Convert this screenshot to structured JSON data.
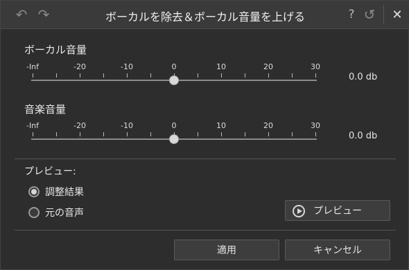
{
  "window": {
    "title": "ボーカルを除去＆ボーカル音量を上げる"
  },
  "titlebar": {
    "undo_icon": "↶",
    "redo_icon": "↷",
    "help_icon": "?",
    "reset_icon": "↺",
    "close_icon": "✕"
  },
  "vocal": {
    "label": "ボーカル音量",
    "ticks": [
      "-Inf",
      "-20",
      "-10",
      "0",
      "10",
      "20",
      "30"
    ],
    "value_text": "0.0 db",
    "level_db": 0
  },
  "music": {
    "label": "音楽音量",
    "ticks": [
      "-Inf",
      "-20",
      "-10",
      "0",
      "10",
      "20",
      "30"
    ],
    "value_text": "0.0 db",
    "level_db": 0
  },
  "preview": {
    "label": "プレビュー:",
    "options": [
      {
        "label": "調整結果",
        "checked": true
      },
      {
        "label": "元の音声",
        "checked": false
      }
    ],
    "button_label": "プレビュー"
  },
  "footer": {
    "apply_label": "適用",
    "cancel_label": "キャンセル"
  }
}
